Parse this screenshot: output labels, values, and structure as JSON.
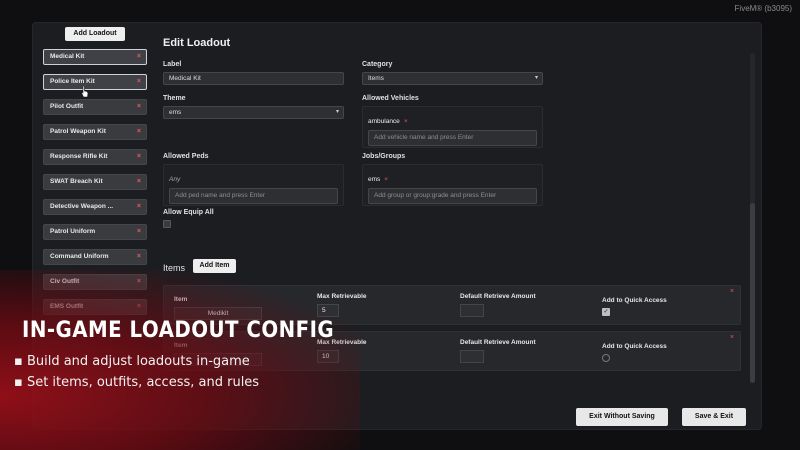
{
  "fivem_tag": "FiveM® (b3095)",
  "sidebar": {
    "add_loadout_label": "Add Loadout",
    "items": [
      {
        "label": "Medical Kit"
      },
      {
        "label": "Police Item Kit"
      },
      {
        "label": "Pilot Outfit"
      },
      {
        "label": "Patrol Weapon Kit"
      },
      {
        "label": "Response Rifle Kit"
      },
      {
        "label": "SWAT Breach Kit"
      },
      {
        "label": "Detective Weapon ..."
      },
      {
        "label": "Patrol Uniform"
      },
      {
        "label": "Command Uniform"
      },
      {
        "label": "Civ Outfit"
      },
      {
        "label": "EMS Outfit"
      }
    ],
    "remove_glyph": "×"
  },
  "editor": {
    "title": "Edit Loadout",
    "label_label": "Label",
    "label_value": "Medical Kit",
    "category_label": "Category",
    "category_value": "Items",
    "theme_label": "Theme",
    "theme_value": "ems",
    "allowed_vehicles_label": "Allowed Vehicles",
    "vehicle_chip": "ambulance",
    "vehicle_placeholder": "Add vehicle name and press Enter",
    "allowed_peds_label": "Allowed Peds",
    "peds_chip": "Any",
    "peds_placeholder": "Add ped name and press Enter",
    "jobs_label": "Jobs/Groups",
    "jobs_chip": "ems",
    "jobs_placeholder": "Add group or group:grade and press Enter",
    "allow_equip_all_label": "Allow Equip All"
  },
  "items_section": {
    "header": "Items",
    "add_item_label": "Add Item",
    "col_item": "Item",
    "col_max": "Max Retrievable",
    "col_default": "Default Retrieve Amount",
    "col_quick": "Add to Quick Access",
    "rows": [
      {
        "item": "Medikit",
        "max": "5",
        "default": "",
        "quick_access": true
      },
      {
        "item": "",
        "max": "10",
        "default": "",
        "quick_access": false
      }
    ]
  },
  "footer": {
    "exit_label": "Exit Without Saving",
    "save_label": "Save & Exit"
  },
  "promo": {
    "title": "IN-GAME LOADOUT CONFIG",
    "bullets": [
      "▪ Build and adjust loadouts in-game",
      "▪ Set items, outfits, access, and rules"
    ]
  },
  "colors": {
    "accent_remove": "#e85b5b",
    "panel": "#1c1d20",
    "promo_red": "#960f19"
  }
}
